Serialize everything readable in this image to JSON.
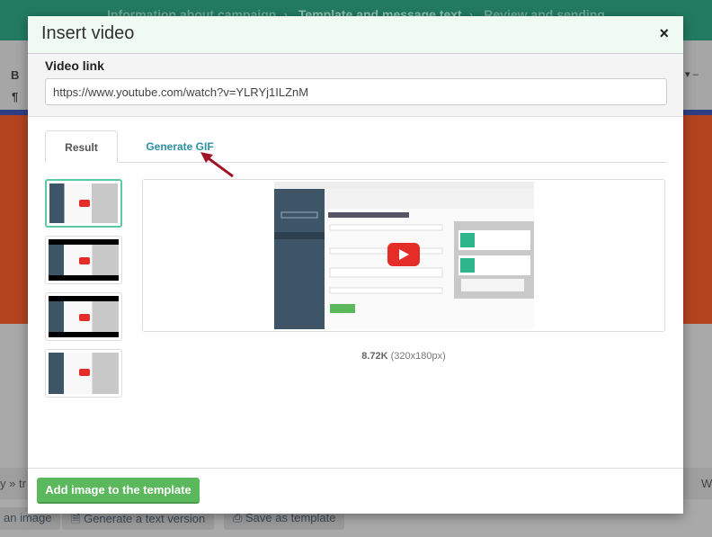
{
  "background": {
    "steps": [
      "Information about campaign",
      "Template and message text",
      "Review and sending"
    ],
    "toolbar": {
      "bold": "B",
      "paragraph": "¶"
    },
    "path_text": "y » tr",
    "path_right": "W",
    "bottom_buttons": [
      "an image",
      "Generate a text version",
      "Save as template"
    ]
  },
  "modal": {
    "title": "Insert video",
    "close_label": "×",
    "video_link_label": "Video link",
    "video_link_value": "https://www.youtube.com/watch?v=YLRYj1ILZnM",
    "tabs": [
      {
        "label": "Result",
        "active": true
      },
      {
        "label": "Generate GIF",
        "active": false
      }
    ],
    "thumbnails_count_selected": 1,
    "preview": {
      "size": "8.72K",
      "dimensions": "(320x180px)"
    },
    "add_button": "Add image to the template"
  },
  "colors": {
    "accent": "#5cb85c",
    "tab_link": "#2a8fa3",
    "arrow": "#a0142a",
    "youtube": "#e52d27"
  }
}
